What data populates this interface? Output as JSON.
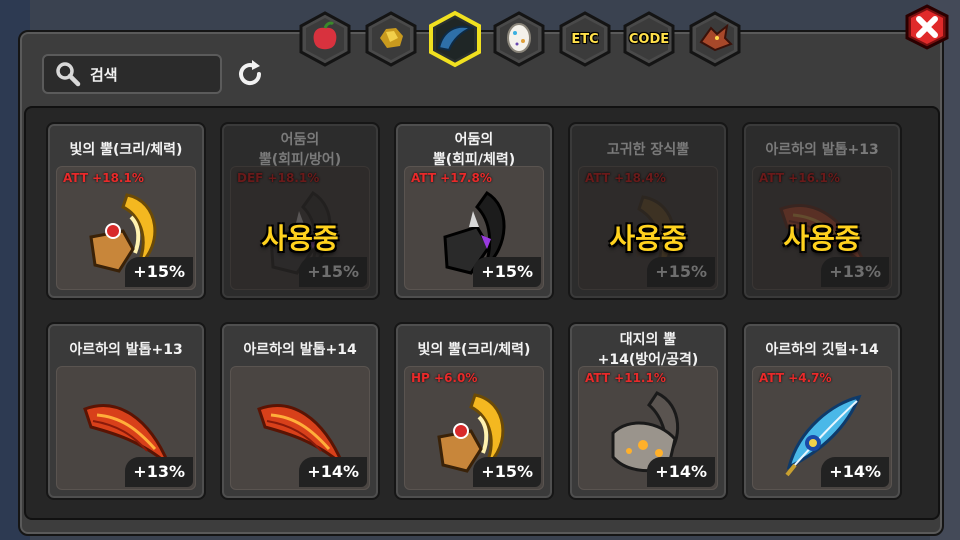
{
  "tabs": [
    {
      "name": "fruit-tab",
      "icon": "red-fruit-icon",
      "label": ""
    },
    {
      "name": "gold-tab",
      "icon": "gold-ore-icon",
      "label": ""
    },
    {
      "name": "horn-tab",
      "icon": "blue-horn-icon",
      "label": "",
      "selected": true
    },
    {
      "name": "egg-tab",
      "icon": "egg-icon",
      "label": ""
    },
    {
      "name": "etc-tab",
      "icon": "",
      "label": "ETC"
    },
    {
      "name": "code-tab",
      "icon": "",
      "label": "CODE"
    },
    {
      "name": "dragon-tab",
      "icon": "dragon-head-icon",
      "label": ""
    }
  ],
  "search": {
    "placeholder": "검색"
  },
  "in_use_label": "사용중",
  "items": [
    {
      "name": "빛의 뿔(크리/체력)",
      "stat": "ATT +18.1%",
      "percent": "+15%",
      "art": "light-horn",
      "in_use": false
    },
    {
      "name": "어둠의\n뿔(회피/방어)",
      "stat": "DEF +18.1%",
      "percent": "+15%",
      "art": "dark-horn",
      "in_use": true
    },
    {
      "name": "어둠의\n뿔(회피/체력)",
      "stat": "ATT +17.8%",
      "percent": "+15%",
      "art": "dark-horn",
      "in_use": false
    },
    {
      "name": "고귀한 장식뿔",
      "stat": "ATT +18.4%",
      "percent": "+15%",
      "art": "noble-horn",
      "in_use": true
    },
    {
      "name": "아르하의 발톱+13",
      "stat": "ATT +16.1%",
      "percent": "+13%",
      "art": "arha-claw",
      "in_use": true
    },
    {
      "name": "아르하의 발톱+13",
      "stat": "",
      "percent": "+13%",
      "art": "arha-claw",
      "in_use": false
    },
    {
      "name": "아르하의 발톱+14",
      "stat": "",
      "percent": "+14%",
      "art": "arha-claw",
      "in_use": false
    },
    {
      "name": "빛의 뿔(크리/체력)",
      "stat": "HP +6.0%",
      "percent": "+15%",
      "art": "light-horn",
      "in_use": false
    },
    {
      "name": "대지의 뿔\n+14(방어/공격)",
      "stat": "ATT +11.1%",
      "percent": "+14%",
      "art": "earth-horn",
      "in_use": false
    },
    {
      "name": "아르하의 깃털+14",
      "stat": "ATT +4.7%",
      "percent": "+14%",
      "art": "arha-feather",
      "in_use": false
    }
  ]
}
